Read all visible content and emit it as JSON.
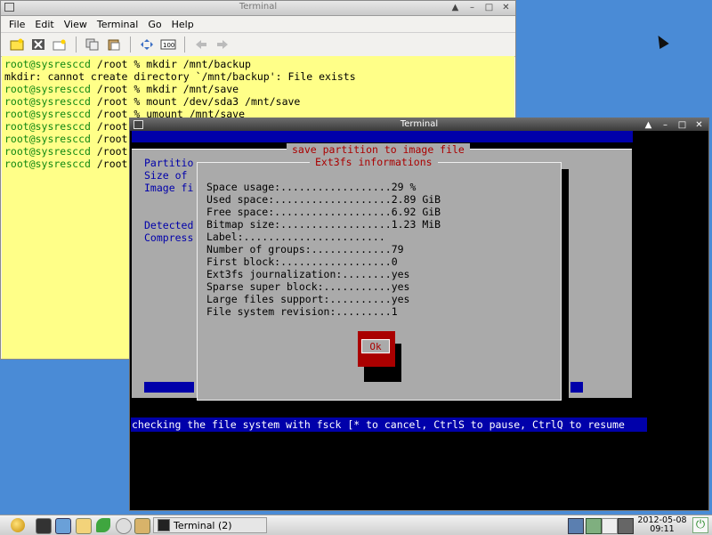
{
  "back_window": {
    "title": "Terminal",
    "menu": [
      "File",
      "Edit",
      "View",
      "Terminal",
      "Go",
      "Help"
    ],
    "toolbar_icons": [
      "new-window-icon",
      "close-window-icon",
      "new-tab-icon",
      "copy-icon",
      "paste-icon",
      "fullscreen-icon",
      "zoom-icon",
      "back-icon",
      "forward-icon"
    ],
    "lines": [
      {
        "prompt": "root@sysresccd",
        "rest": " /root % mkdir /mnt/backup"
      },
      {
        "prompt": "",
        "rest": "mkdir: cannot create directory `/mnt/backup': File exists"
      },
      {
        "prompt": "root@sysresccd",
        "rest": " /root % mkdir /mnt/save"
      },
      {
        "prompt": "root@sysresccd",
        "rest": " /root % mount /dev/sda3 /mnt/save"
      },
      {
        "prompt": "root@sysresccd",
        "rest": " /root % umount /mnt/save"
      },
      {
        "prompt": "root@sysresccd",
        "rest": " /root"
      },
      {
        "prompt": "root@sysresccd",
        "rest": " /root"
      },
      {
        "prompt": "root@sysresccd",
        "rest": " /root"
      },
      {
        "prompt": "root@sysresccd",
        "rest": " /root"
      }
    ]
  },
  "front_window": {
    "title": "Terminal",
    "outer_dialog_title": "save partition to image file",
    "inner_dialog_title": "Ext3fs informations",
    "bg_labels": [
      "Partitio",
      "Size of",
      "Image fi",
      "Detected",
      "Compress"
    ],
    "info_rows": [
      "Space usage:..................29 %",
      "Used space:...................2.89 GiB",
      "Free space:...................6.92 GiB",
      "Bitmap size:..................1.23 MiB",
      "Label:.......................",
      "Number of groups:.............79",
      "First block:..................0",
      "Ext3fs journalization:........yes",
      "Sparse super block:...........yes",
      "Large files support:..........yes",
      "File system revision:.........1"
    ],
    "ok_label": "Ok",
    "status_line": "checking the file system with fsck [* to cancel, CtrlS to pause, CtrlQ to resume"
  },
  "taskbar": {
    "task_label": "Terminal (2)",
    "clock_date": "2012-05-08",
    "clock_time": "09:11"
  },
  "colors": {
    "terminal_bg": "#ffff88",
    "prompt": "#118811",
    "ncurses_blue": "#0000aa",
    "ncurses_grey": "#aaaaaa",
    "ncurses_red": "#aa0000"
  }
}
